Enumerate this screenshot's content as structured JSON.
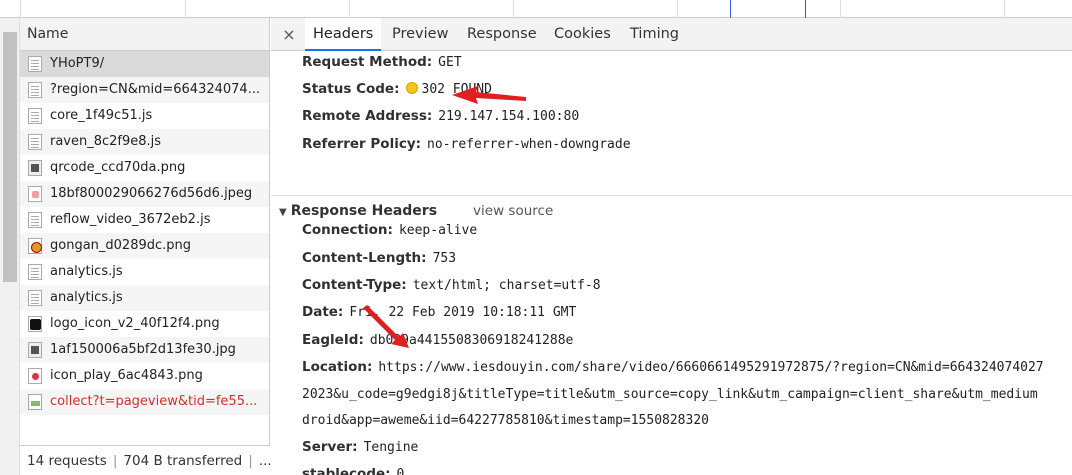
{
  "request_list": {
    "column_header": "Name",
    "rows": [
      {
        "name": "YHoPT9/",
        "icon": "document-icon",
        "state": "selected"
      },
      {
        "name": "?region=CN&mid=664324074...",
        "icon": "document-icon"
      },
      {
        "name": "core_1f49c51.js",
        "icon": "document-icon"
      },
      {
        "name": "raven_8c2f9e8.js",
        "icon": "document-icon"
      },
      {
        "name": "qrcode_ccd70da.png",
        "icon": "image-icon"
      },
      {
        "name": "18bf800029066276d56d6.jpeg",
        "icon": "image-icon"
      },
      {
        "name": "reflow_video_3672eb2.js",
        "icon": "document-icon"
      },
      {
        "name": "gongan_d0289dc.png",
        "icon": "image-icon"
      },
      {
        "name": "analytics.js",
        "icon": "document-icon"
      },
      {
        "name": "analytics.js",
        "icon": "document-icon"
      },
      {
        "name": "logo_icon_v2_40f12f4.png",
        "icon": "image-icon"
      },
      {
        "name": "1af150006a5bf2d13fe30.jpg",
        "icon": "image-icon"
      },
      {
        "name": "icon_play_6ac4843.png",
        "icon": "image-icon"
      },
      {
        "name": "collect?t=pageview&tid=fe55...",
        "icon": "broken-image-icon",
        "state": "error"
      }
    ],
    "status": {
      "requests": "14 requests",
      "transferred": "704 B transferred",
      "more": "..."
    }
  },
  "detail": {
    "close_symbol": "×",
    "tabs": [
      "Headers",
      "Preview",
      "Response",
      "Cookies",
      "Timing"
    ],
    "active_tab": "Headers",
    "general": {
      "request_method": {
        "key": "Request Method:",
        "value": "GET"
      },
      "status_code": {
        "key": "Status Code:",
        "value": "302 FOUND",
        "dot_color": "#f5c518"
      },
      "remote_address": {
        "key": "Remote Address:",
        "value": "219.147.154.100:80"
      },
      "referrer_policy": {
        "key": "Referrer Policy:",
        "value": "no-referrer-when-downgrade"
      }
    },
    "response_headers": {
      "title": "Response Headers",
      "view_source": "view source",
      "connection": {
        "key": "Connection:",
        "value": "keep-alive"
      },
      "content_length": {
        "key": "Content-Length:",
        "value": "753"
      },
      "content_type": {
        "key": "Content-Type:",
        "value": "text/html; charset=utf-8"
      },
      "date": {
        "key": "Date:",
        "value": "Fri, 22 Feb 2019 10:18:11 GMT"
      },
      "eagleid": {
        "key": "EagleId:",
        "value": "db039a4415508306918241288e"
      },
      "location": {
        "key": "Location:",
        "value_line1": "https://www.iesdouyin.com/share/video/6660661495291972875/?region=CN&mid=664324074027",
        "value_line2": "2023&u_code=g9edgi8j&titleType=title&utm_source=copy_link&utm_campaign=client_share&utm_medium",
        "value_line3": "droid&app=aweme&iid=64227785810&timestamp=1550828320"
      },
      "server": {
        "key": "Server:",
        "value": "Tengine"
      },
      "stablecode": {
        "key": "stablecode:",
        "value": "0"
      }
    }
  },
  "annotation_color": "#e02020"
}
